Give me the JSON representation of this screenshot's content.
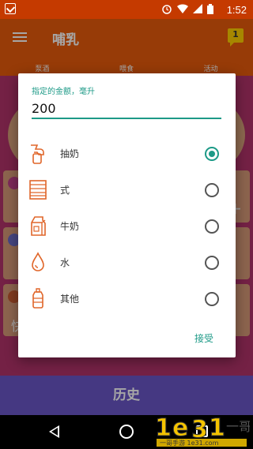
{
  "status_bar": {
    "time": "1:52"
  },
  "app_bar": {
    "title": "哺乳",
    "badge": "1"
  },
  "tabs": [
    {
      "label": "泵酒"
    },
    {
      "label": "喂食"
    },
    {
      "label": "活动"
    }
  ],
  "background": {
    "card3_text": "快"
  },
  "dialog": {
    "amount_label": "指定的金额，毫升",
    "amount_value": "200",
    "options": [
      {
        "label": "抽奶",
        "icon": "breast-pump-icon",
        "selected": true
      },
      {
        "label": "式",
        "icon": "formula-icon",
        "selected": false
      },
      {
        "label": "牛奶",
        "icon": "milk-carton-icon",
        "selected": false
      },
      {
        "label": "水",
        "icon": "water-drop-icon",
        "selected": false
      },
      {
        "label": "其他",
        "icon": "bottle-icon",
        "selected": false
      }
    ],
    "accept_label": "接受"
  },
  "history_bar": {
    "label": "历史"
  },
  "watermark": {
    "text": "一哥手游 1e31.com"
  },
  "colors": {
    "status_bar": "#c53a00",
    "app_bar": "#e95b0b",
    "accent": "#1d9a87",
    "icon_orange": "#e0662a",
    "history_bar": "#6b57c8"
  }
}
